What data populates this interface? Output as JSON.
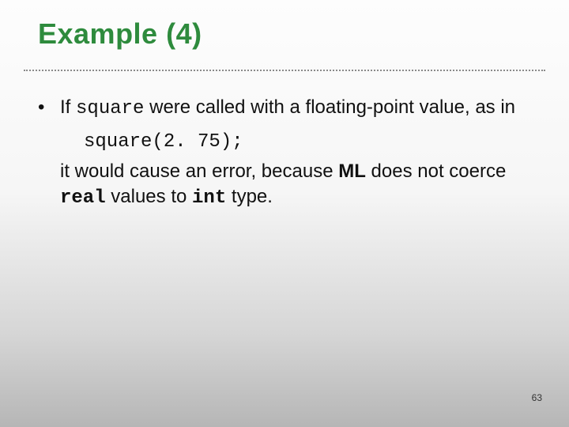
{
  "title": "Example (4)",
  "bullet_mark": "•",
  "line1_a": "If ",
  "line1_code": "square",
  "line1_b": " were called with a floating-point value, as in",
  "code_line": "square(2. 75);",
  "line2_a": "it would cause an error, because ",
  "line2_ml": "ML",
  "line2_b": " does not coerce ",
  "line2_real": "real",
  "line2_c": " values to ",
  "line2_int": "int",
  "line2_d": " type.",
  "page_number": "63"
}
